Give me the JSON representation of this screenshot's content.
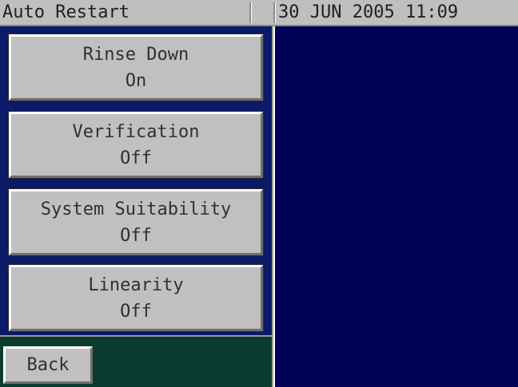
{
  "header": {
    "title": "Auto Restart",
    "datetime": "30 JUN 2005 11:09"
  },
  "menu": {
    "items": [
      {
        "label": "Rinse Down",
        "value": "On"
      },
      {
        "label": "Verification",
        "value": "Off"
      },
      {
        "label": "System Suitability",
        "value": "Off"
      },
      {
        "label": "Linearity",
        "value": "Off"
      }
    ]
  },
  "footer": {
    "back_label": "Back"
  },
  "colors": {
    "title_bar": "#bfbfbf",
    "left_panel": "#0a1a66",
    "right_panel": "#000055",
    "footer": "#0b3a2e",
    "button_face": "#c0c0c0"
  }
}
